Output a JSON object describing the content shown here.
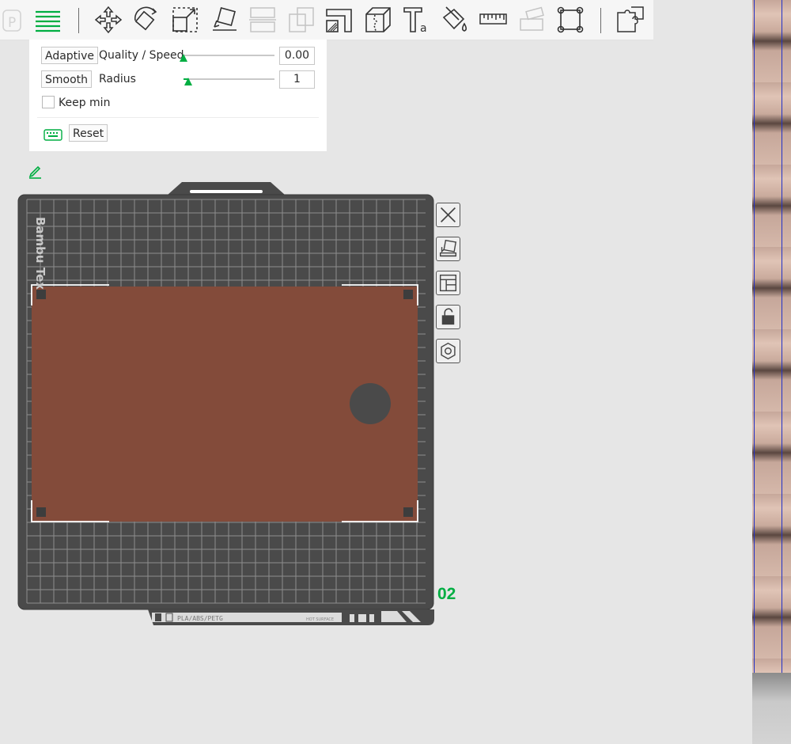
{
  "toolbar": {
    "icons": [
      "plate-icon",
      "layers-icon",
      "move-icon",
      "rotate-icon",
      "scale-icon",
      "lay-on-face-icon",
      "cut-icon",
      "boolean-icon",
      "support-painting-icon",
      "seam-painting-icon",
      "text-icon",
      "color-painting-icon",
      "measure-icon",
      "assembly-icon",
      "fit-frame-icon",
      "split-parts-icon"
    ]
  },
  "panel": {
    "adaptive_label": "Adaptive",
    "quality_speed_label": "Quality / Speed",
    "quality_speed_value": "0.00",
    "quality_speed_fraction": 0.0,
    "smooth_label": "Smooth",
    "radius_label": "Radius",
    "radius_value": "1",
    "radius_fraction": 0.05,
    "keep_min_label": "Keep min",
    "keep_min_checked": false,
    "reset_label": "Reset",
    "keyboard_icon": "keyboard-icon"
  },
  "plate": {
    "brand_text": "Bambu Tex",
    "bottom_label": "PLA/ABS/PETG",
    "hot_surface_label": "HOT SURFACE",
    "plate_number": "02",
    "model_color": "#834b3a",
    "bed_color": "#4a4a4a"
  },
  "side_buttons": [
    "close-icon",
    "auto-orient-icon",
    "arrange-icon",
    "lock-icon",
    "plate-settings-icon"
  ],
  "colors": {
    "accent": "#00ae42"
  }
}
